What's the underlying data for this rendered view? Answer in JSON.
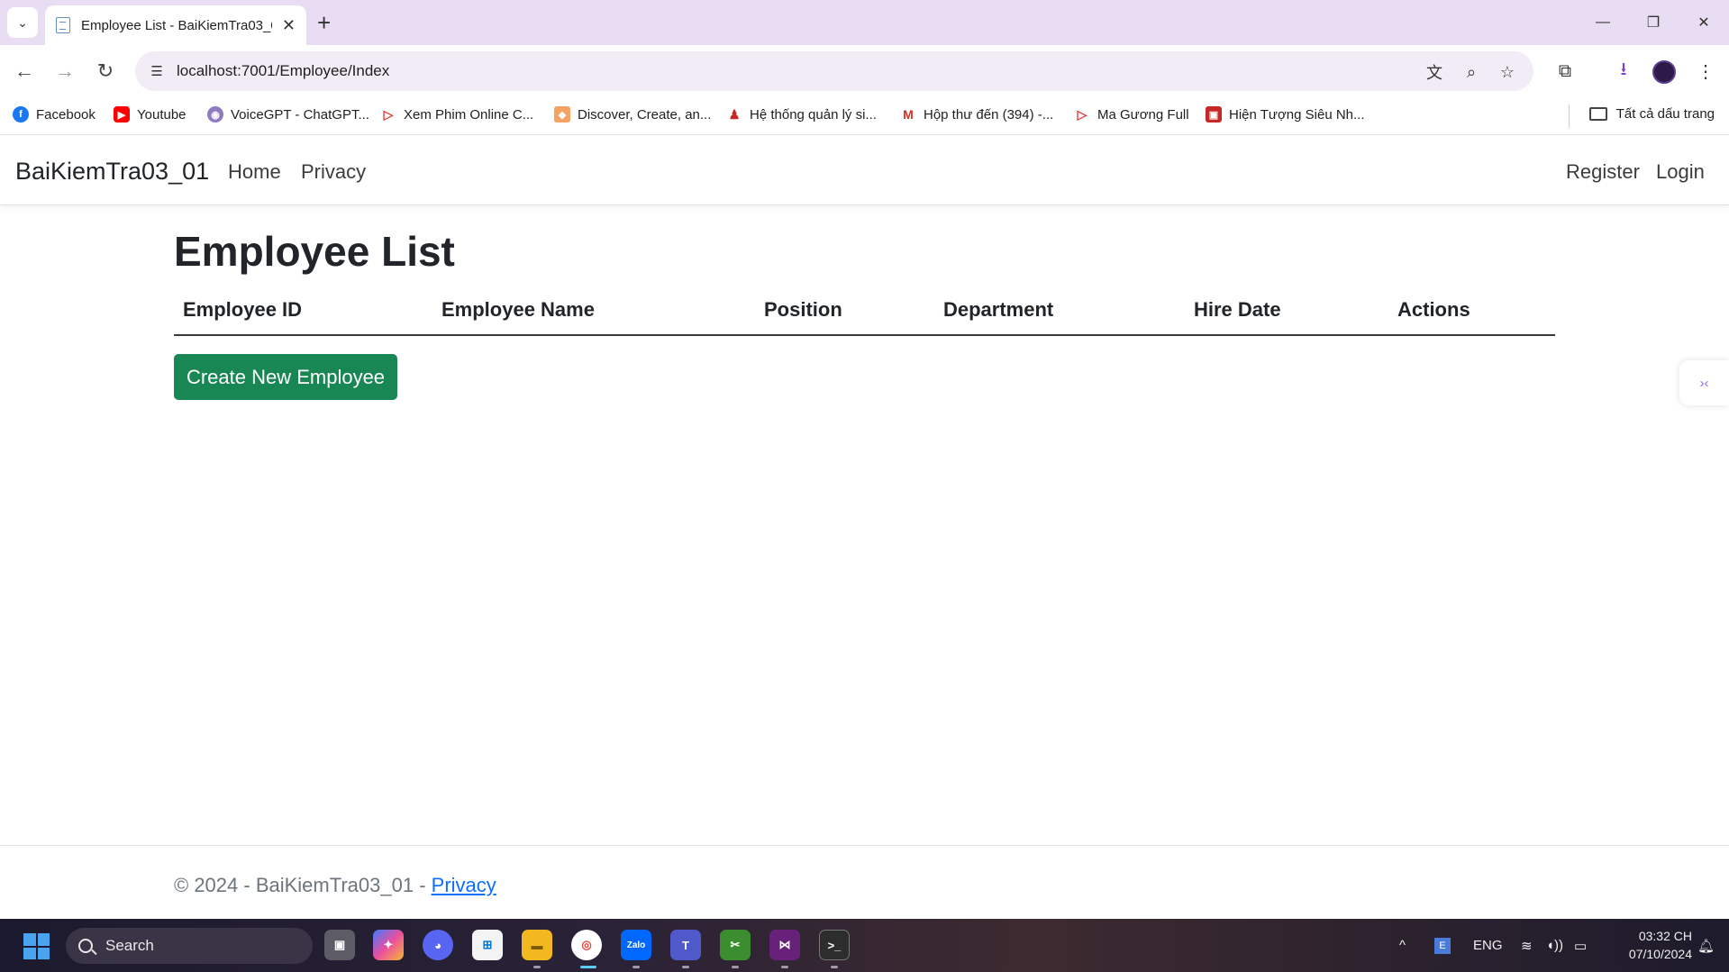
{
  "browser": {
    "tab_title": "Employee List - BaiKiemTra03_0",
    "url": "localhost:7001/Employee/Index",
    "bookmarks": [
      {
        "label": "Facebook",
        "icon": "facebook-icon",
        "color": "#1877f2"
      },
      {
        "label": "Youtube",
        "icon": "youtube-icon",
        "color": "#ff0000"
      },
      {
        "label": "VoiceGPT - ChatGPT...",
        "icon": "voicegpt-icon",
        "color": "#8e7cc3"
      },
      {
        "label": "Xem Phim Online C...",
        "icon": "play-icon",
        "color": "#e53935"
      },
      {
        "label": "Discover, Create, an...",
        "icon": "discover-icon",
        "color": "#f4a261"
      },
      {
        "label": "Hệ thống quản lý si...",
        "icon": "student-icon",
        "color": "#c62828"
      },
      {
        "label": "Hộp thư đến (394) -...",
        "icon": "gmail-icon",
        "color": "#d93025"
      },
      {
        "label": "Ma Gương Full",
        "icon": "play-icon",
        "color": "#e53935"
      },
      {
        "label": "Hiện Tượng Siêu Nh...",
        "icon": "video-icon",
        "color": "#c62828"
      }
    ],
    "all_bookmarks_label": "Tất cả dấu trang"
  },
  "site": {
    "brand": "BaiKiemTra03_01",
    "nav": {
      "home": "Home",
      "privacy": "Privacy",
      "register": "Register",
      "login": "Login"
    },
    "page_title": "Employee List",
    "table_headers": [
      "Employee ID",
      "Employee Name",
      "Position",
      "Department",
      "Hire Date",
      "Actions"
    ],
    "create_button": "Create New Employee",
    "footer_text": "© 2024 - BaiKiemTra03_01 - ",
    "footer_link": "Privacy",
    "accent_color": "#198754"
  },
  "taskbar": {
    "search_label": "Search",
    "language": "ENG",
    "time": "03:32 CH",
    "date": "07/10/2024"
  }
}
